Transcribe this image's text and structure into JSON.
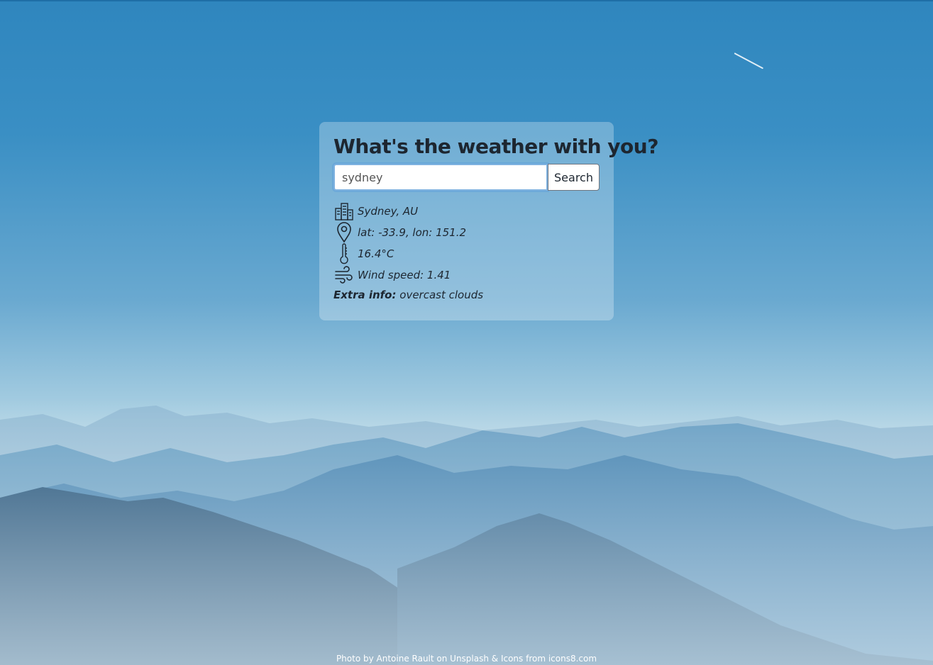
{
  "page": {
    "title": "What's the weather with you?"
  },
  "search": {
    "value": "sydney",
    "button_label": "Search"
  },
  "weather": {
    "location": "Sydney, AU",
    "coordinates": "lat: -33.9, lon: 151.2",
    "temperature": "16.4°C",
    "wind": "Wind speed: 1.41",
    "extra_label": "Extra info:",
    "extra_value": "overcast clouds"
  },
  "icons": {
    "location": "city-buildings-icon",
    "coordinates": "map-pin-icon",
    "temperature": "thermometer-icon",
    "wind": "wind-icon"
  },
  "footer": {
    "credit": "Photo by Antoine Rault on Unsplash & Icons from icons8.com"
  },
  "colors": {
    "sky_top": "#2f86be",
    "mountain_dark": "#1f5077",
    "text": "#1d2630"
  }
}
